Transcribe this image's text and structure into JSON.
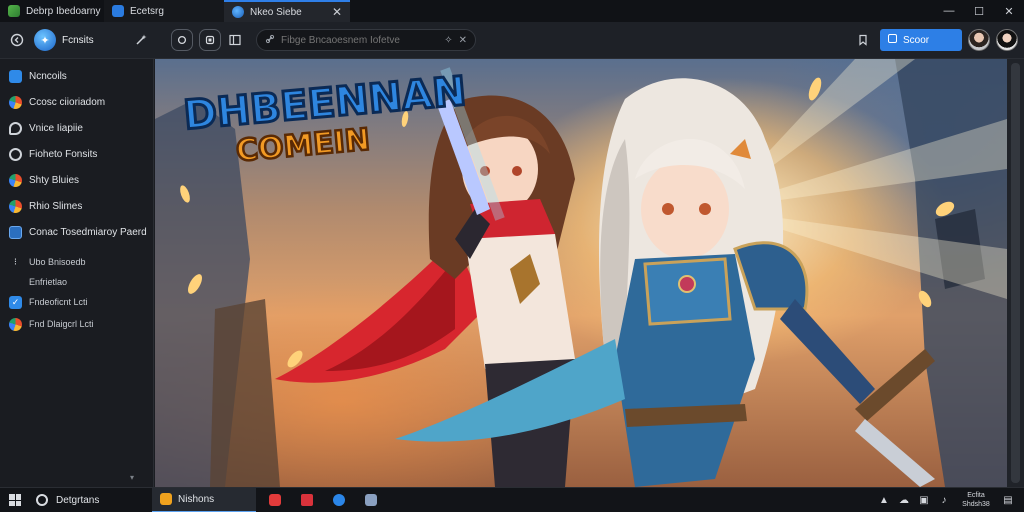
{
  "tabs": [
    {
      "label": "Debrp Ibedoarny",
      "icon": "grass-block-icon"
    },
    {
      "label": "Ecetsrg",
      "icon": "app-icon"
    },
    {
      "label": "Nkeo Siebe",
      "icon": "globe-icon",
      "active": true
    }
  ],
  "window_controls": {
    "minimize": "—",
    "maximize": "☐",
    "close": "✕"
  },
  "toolbar": {
    "brand_label": "Fcnsits",
    "address_placeholder": "Fibge Bncaoesnem Iofetve",
    "search_label": "Scoor"
  },
  "sidebar": {
    "items": [
      {
        "label": "Ncncoils",
        "icon": "blue-square-icon"
      },
      {
        "label": "Ccosc ciioriadom",
        "icon": "color-wheel-icon"
      },
      {
        "label": "Vnice Iiapiie",
        "icon": "chat-icon"
      },
      {
        "label": "Fioheto Fonsits",
        "icon": "gear-icon"
      },
      {
        "label": "Shty Bluies",
        "icon": "color-wheel-icon"
      },
      {
        "label": "Rhio Slimes",
        "icon": "color-wheel-icon"
      },
      {
        "label": "Conac Tosedmiaroy Paerd",
        "icon": "box-icon"
      }
    ],
    "sub_items": [
      {
        "label": "Ubo Bnisoedb",
        "icon": "dots-icon"
      },
      {
        "label": "Enfrietlao",
        "icon": "none"
      },
      {
        "label": "Fndeoficnt Lcti",
        "icon": "check-icon"
      },
      {
        "label": "Fnd Dlaigcrl Lcti",
        "icon": "color-wheel-icon"
      }
    ]
  },
  "artwork": {
    "logo_line1": "DHBEENNAN",
    "logo_line2": "COMEIN"
  },
  "taskbar": {
    "search_label": "Detgrtans",
    "active_app_label": "Nishons",
    "clock_line1": "Ecfita",
    "clock_line2": "Shdsh38"
  },
  "colors": {
    "accent": "#2d7fe6",
    "titlebar": "#101216",
    "sidebar": "#1a1c21"
  }
}
